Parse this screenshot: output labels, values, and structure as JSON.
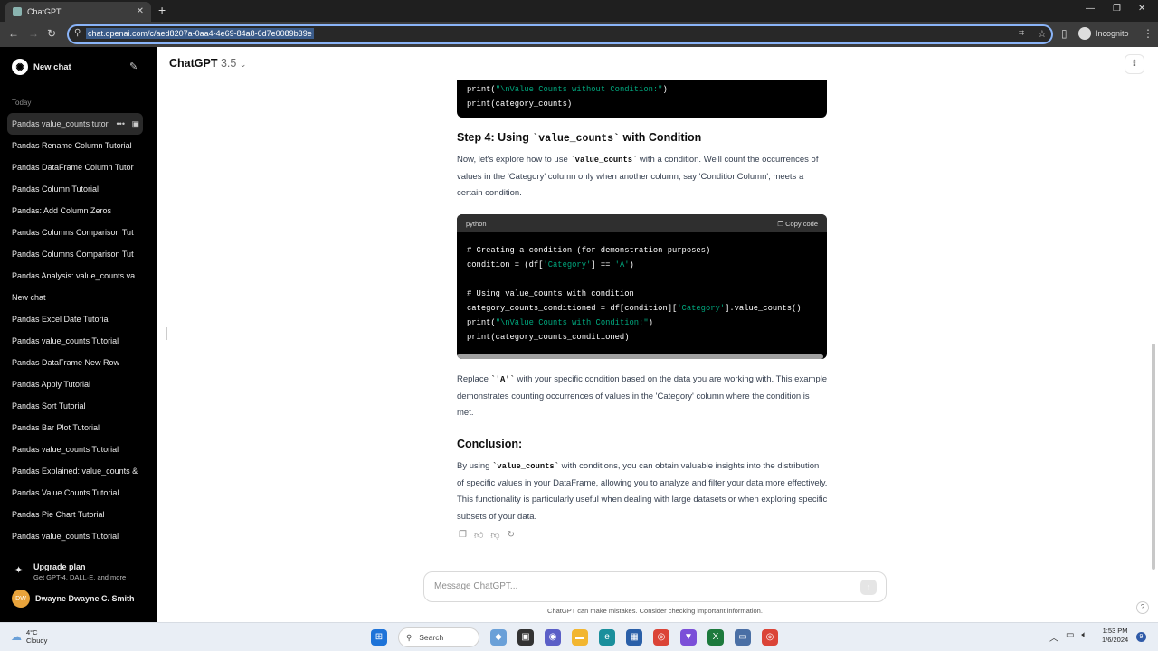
{
  "browser": {
    "tab_title": "ChatGPT",
    "url": "chat.openai.com/c/aed8207a-0aa4-4e69-84a8-6d7e0089b39e",
    "profile": "Incognito"
  },
  "sidebar": {
    "new_chat": "New chat",
    "section": "Today",
    "items": [
      {
        "label": "Pandas value_counts tutor"
      },
      {
        "label": "Pandas Rename Column Tutorial"
      },
      {
        "label": "Pandas DataFrame Column Tutor"
      },
      {
        "label": "Pandas Column Tutorial"
      },
      {
        "label": "Pandas: Add Column Zeros"
      },
      {
        "label": "Pandas Columns Comparison Tut"
      },
      {
        "label": "Pandas Columns Comparison Tut"
      },
      {
        "label": "Pandas Analysis: value_counts va"
      },
      {
        "label": "New chat"
      },
      {
        "label": "Pandas Excel Date Tutorial"
      },
      {
        "label": "Pandas value_counts Tutorial"
      },
      {
        "label": "Pandas DataFrame New Row"
      },
      {
        "label": "Pandas Apply Tutorial"
      },
      {
        "label": "Pandas Sort Tutorial"
      },
      {
        "label": "Pandas Bar Plot Tutorial"
      },
      {
        "label": "Pandas value_counts Tutorial"
      },
      {
        "label": "Pandas Explained: value_counts &"
      },
      {
        "label": "Pandas Value Counts Tutorial"
      },
      {
        "label": "Pandas Pie Chart Tutorial"
      },
      {
        "label": "Pandas value_counts Tutorial"
      }
    ],
    "upgrade_title": "Upgrade plan",
    "upgrade_sub": "Get GPT-4, DALL·E, and more",
    "user_initials": "DW",
    "user_name": "Dwayne Dwayne C. Smith"
  },
  "header": {
    "model": "ChatGPT",
    "version": "3.5"
  },
  "content": {
    "code_top": [
      {
        "fn": "print(",
        "str": "\"\\nValue Counts without Condition:\"",
        "end": ")"
      },
      {
        "plain": "print(category_counts)"
      }
    ],
    "step4_prefix": "Step 4: Using ",
    "step4_code": "`value_counts`",
    "step4_suffix": " with Condition",
    "p1_a": "Now, let's explore how to use ",
    "p1_code": "`value_counts`",
    "p1_b": " with a condition. We'll count the occurrences of values in the 'Category' column only when another column, say 'ConditionColumn', meets a certain condition.",
    "code_lang": "python",
    "copy_label": "Copy code",
    "code_lines": {
      "l1": "# Creating a condition (for demonstration purposes)",
      "l2a": "condition = (df[",
      "l2s": "'Category'",
      "l2b": "] == ",
      "l2s2": "'A'",
      "l2c": ")",
      "l3": "# Using value_counts with condition",
      "l4a": "category_counts_conditioned = df[condition][",
      "l4s": "'Category'",
      "l4b": "].value_counts()",
      "l5a": "print(",
      "l5s": "\"\\nValue Counts with Condition:\"",
      "l5b": ")",
      "l6": "print(category_counts_conditioned)"
    },
    "p2_a": "Replace ",
    "p2_code": "`'A'`",
    "p2_b": " with your specific condition based on the data you are working with. This example demonstrates counting occurrences of values in the 'Category' column where the condition is met.",
    "conclusion": "Conclusion:",
    "p3_a": "By using ",
    "p3_code": "`value_counts`",
    "p3_b": " with conditions, you can obtain valuable insights into the distribution of specific values in your DataFrame, allowing you to analyze and filter your data more effectively. This functionality is particularly useful when dealing with large datasets or when exploring specific subsets of your data."
  },
  "composer": {
    "placeholder": "Message ChatGPT...",
    "disclaimer": "ChatGPT can make mistakes. Consider checking important information."
  },
  "taskbar": {
    "temp": "4°C",
    "weather": "Cloudy",
    "search": "Search",
    "time": "1:53 PM",
    "date": "1/6/2024",
    "notifications": "9"
  }
}
